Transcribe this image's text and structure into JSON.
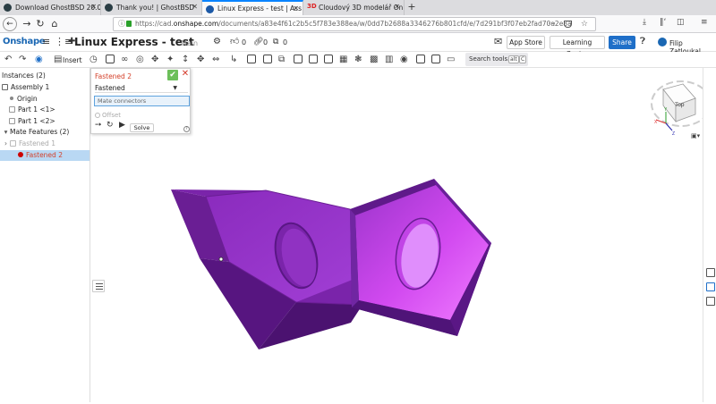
{
  "browser": {
    "tabs": [
      {
        "label": "Download GhostBSD 20.0",
        "active": false,
        "icon": "ghostbsd-favicon"
      },
      {
        "label": "Thank you! | GhostBSD",
        "active": false,
        "icon": "ghostbsd-favicon"
      },
      {
        "label": "Linux Express - test | Ass",
        "active": true,
        "icon": "onshape-favicon"
      },
      {
        "label": "Cloudový 3D modelář On",
        "active": false,
        "icon": "3d-favicon"
      }
    ],
    "new_tab_glyph": "+",
    "close_glyph": "✕",
    "url_prefix": "https://cad.",
    "url_domain": "onshape.com",
    "url_rest": "/documents/a83e4f61c2b5c5f783e388ea/w/0dd7b2688a3346276b801cfd/e/7d291bf3f07eb2fad70a2e8a",
    "url_more": "···"
  },
  "header": {
    "logo": "Onshape",
    "doc_title": "Linux Express - test",
    "branch": "Main",
    "likes": "0",
    "links": "0",
    "copies": "0",
    "app_store": "App Store",
    "learning_center": "Learning Center",
    "share": "Share",
    "user": "Filip Zatloukal"
  },
  "toolbar": {
    "insert": "Insert",
    "search_tools": "Search tools...",
    "kbd1": "alt",
    "kbd2": "C"
  },
  "sidebar": {
    "instances": "Instances (2)",
    "assembly": "Assembly 1",
    "origin": "Origin",
    "part1": "Part 1 <1>",
    "part2": "Part 1 <2>",
    "mate_features": "Mate Features (2)",
    "fastened1": "Fastened 1",
    "fastened2": "Fastened 2"
  },
  "dialog": {
    "title": "Fastened 2",
    "type": "Fastened",
    "mate_connectors_placeholder": "Mate connectors",
    "offset": "Offset",
    "solve": "Solve",
    "help": "?"
  },
  "viewcube": {
    "face": "Top",
    "axis_x": "X",
    "axis_y": "Y",
    "axis_z": "Z"
  },
  "colors": {
    "accent": "#1f6fc8",
    "part_purple": "#9a2fc4",
    "error": "#d4402a",
    "selection": "#b9d8f3"
  }
}
